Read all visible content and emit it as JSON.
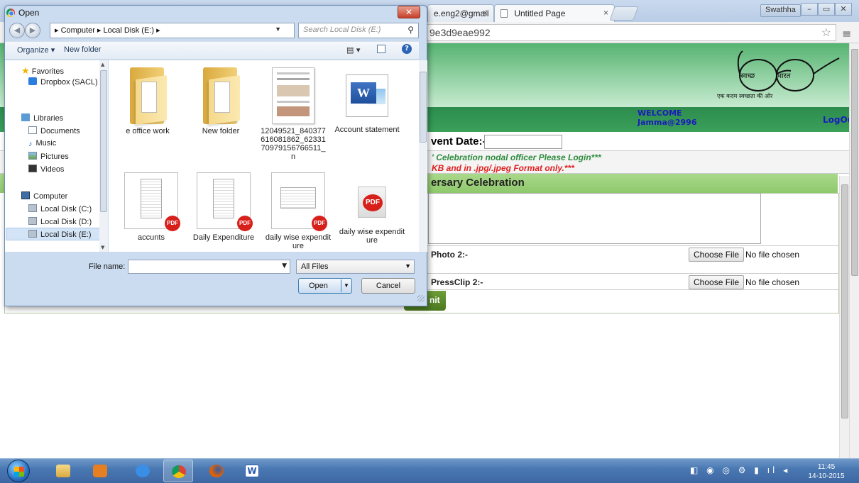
{
  "browser": {
    "tabs": [
      {
        "label": "e.eng2@gmail",
        "close": "×"
      },
      {
        "label": "Untitled Page",
        "close": "×"
      }
    ],
    "user": "Swathha",
    "window_controls": [
      "–",
      "▭",
      "✕"
    ],
    "url": "9e3d9eae992",
    "star_icon": "☆",
    "menu_icon": "≡"
  },
  "page": {
    "logo_text_left": "स्वच्छ",
    "logo_text_right": "भारत",
    "logo_tagline": "एक कदम स्वच्छता की ओर",
    "welcome_label": "WELCOME",
    "welcome_user": "Jamma@2996",
    "logout": "LogOut",
    "event_date_label": "vent Date:-",
    "notice_login": "' Celebration nodal officer Please Login***",
    "notice_format": "KB and in .jpg/.jpeg Format only.***",
    "section_title": "ersary Celebration",
    "photo2_label": "Photo 2:-",
    "pressclip2_label": "PressClip 2:-",
    "choose_file": "Choose File",
    "no_file": "No file chosen",
    "submit": "nit"
  },
  "dialog": {
    "title": "Open",
    "close_icon": "✕",
    "breadcrumb": "▸ Computer ▸ Local Disk (E:) ▸",
    "search_placeholder": "Search Local Disk (E:)",
    "organize": "Organize ▾",
    "new_folder": "New folder",
    "view_icon": "▤ ▾",
    "help": "?",
    "nav": {
      "favorites": "Favorites",
      "dropbox": "Dropbox (SACL)",
      "libraries": "Libraries",
      "documents": "Documents",
      "music": "Music",
      "pictures": "Pictures",
      "videos": "Videos",
      "computer": "Computer",
      "disk_c": "Local Disk (C:)",
      "disk_d": "Local Disk (D:)",
      "disk_e": "Local Disk (E:)"
    },
    "files": [
      {
        "name": "e office work",
        "type": "folder"
      },
      {
        "name": "New folder",
        "type": "folder"
      },
      {
        "name": "12049521_840377616081862_6233170979156766511_n",
        "type": "image"
      },
      {
        "name": "Account statement",
        "type": "word"
      },
      {
        "name": "accunts",
        "type": "pdf"
      },
      {
        "name": "Daily Expenditure",
        "type": "pdf"
      },
      {
        "name": "daily wise expenditure",
        "type": "pdf"
      },
      {
        "name": "daily wise expenditure",
        "type": "pdf"
      }
    ],
    "file_name_label": "File name:",
    "file_name_value": "",
    "filter_value": "All Files",
    "open_button": "Open",
    "cancel_button": "Cancel"
  },
  "taskbar": {
    "apps": [
      "explorer",
      "media-player",
      "internet-explorer",
      "chrome",
      "firefox",
      "word"
    ],
    "tray_icons": "◧ ◉ ◎ ⚙ ▮ ıl ◂",
    "time": "11:45",
    "date": "14-10-2015"
  }
}
